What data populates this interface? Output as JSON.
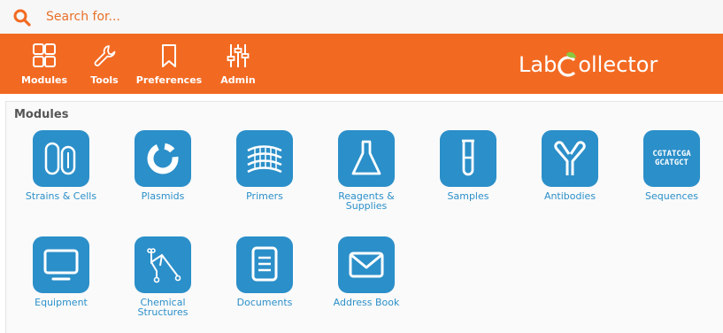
{
  "search": {
    "placeholder": "Search for..."
  },
  "toolbar": {
    "items": [
      {
        "label": "Modules",
        "icon": "grid-icon"
      },
      {
        "label": "Tools",
        "icon": "wrench-icon"
      },
      {
        "label": "Preferences",
        "icon": "bookmark-icon"
      },
      {
        "label": "Admin",
        "icon": "sliders-icon"
      }
    ],
    "logo": {
      "left": "Lab",
      "right": "ollector"
    }
  },
  "colors": {
    "brand": "#f26a22",
    "module_tile": "#2b8fc9",
    "logo_accent": "#8cc63f"
  },
  "panel": {
    "title": "Modules",
    "modules": [
      {
        "label": "Strains & Cells",
        "icon": "strains-cells-icon"
      },
      {
        "label": "Plasmids",
        "icon": "plasmid-icon"
      },
      {
        "label": "Primers",
        "icon": "primers-icon"
      },
      {
        "label": "Reagents & Supplies",
        "icon": "flask-icon"
      },
      {
        "label": "Samples",
        "icon": "test-tube-icon"
      },
      {
        "label": "Antibodies",
        "icon": "antibody-icon"
      },
      {
        "label": "Sequences",
        "icon": "sequences-icon",
        "tile_text": [
          "CGTATCGA",
          "GCATGCT"
        ]
      },
      {
        "label": "Equipment",
        "icon": "monitor-icon"
      },
      {
        "label": "Chemical Structures",
        "icon": "chemical-structure-icon"
      },
      {
        "label": "Documents",
        "icon": "document-icon"
      },
      {
        "label": "Address Book",
        "icon": "envelope-icon"
      }
    ]
  }
}
